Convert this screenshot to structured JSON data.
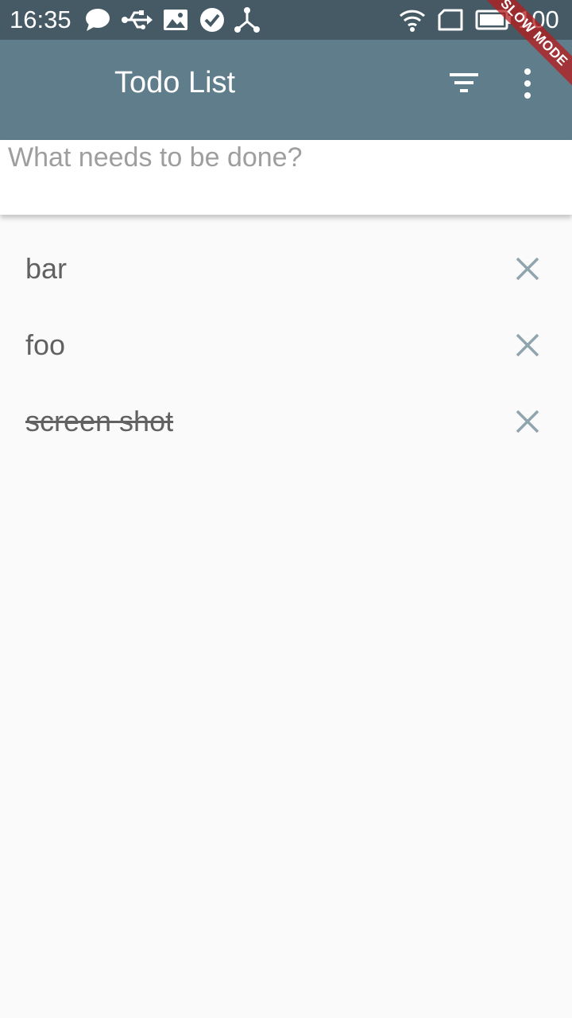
{
  "status_bar": {
    "time": "16:35",
    "battery": "100",
    "icons": [
      "chat-bubble-icon",
      "usb-icon",
      "image-icon",
      "check-circle-icon",
      "share-icon",
      "wifi-icon",
      "sim-card-icon",
      "battery-icon"
    ]
  },
  "debug_banner": "SLOW MODE",
  "app_bar": {
    "title": "Todo List",
    "actions": [
      "filter-icon",
      "more-vert-icon"
    ]
  },
  "input": {
    "placeholder": "What needs to be done?",
    "value": ""
  },
  "todos": [
    {
      "title": "bar",
      "completed": false
    },
    {
      "title": "foo",
      "completed": false
    },
    {
      "title": "screen shot",
      "completed": true
    }
  ],
  "colors": {
    "status_bar": "#455a64",
    "app_bar": "#607d8b",
    "background": "#fafafa",
    "delete_icon": "#90a4ae"
  }
}
